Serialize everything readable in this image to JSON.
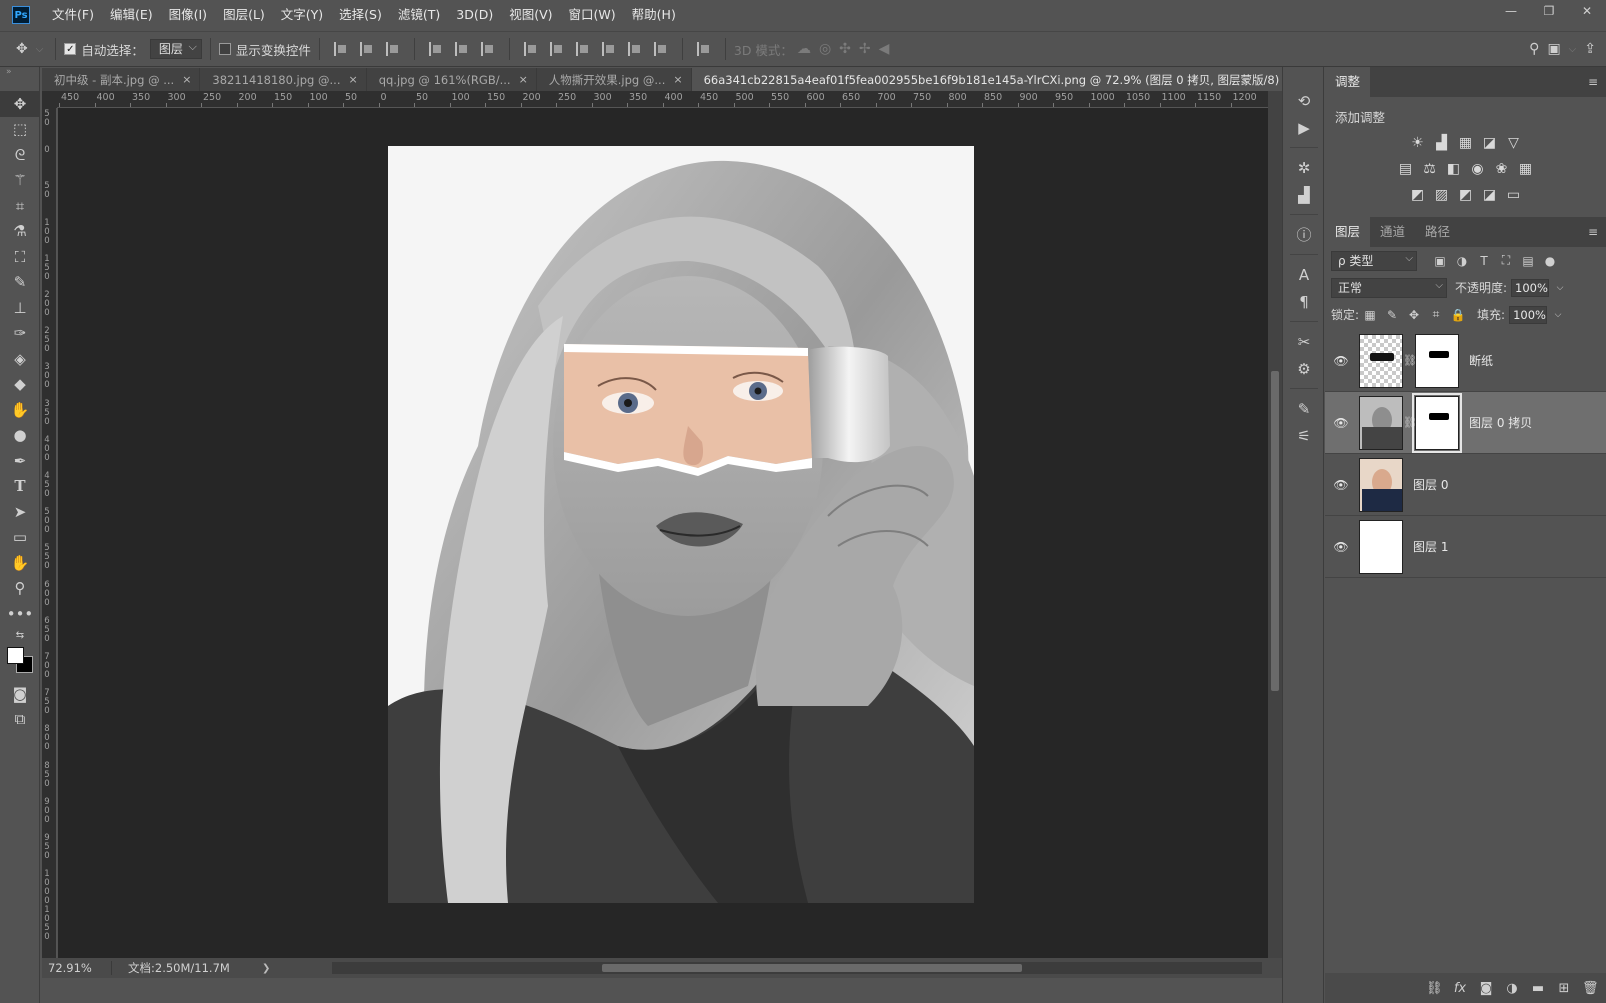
{
  "app": {
    "logo": "Ps"
  },
  "menu": [
    "文件(F)",
    "编辑(E)",
    "图像(I)",
    "图层(L)",
    "文字(Y)",
    "选择(S)",
    "滤镜(T)",
    "3D(D)",
    "视图(V)",
    "窗口(W)",
    "帮助(H)"
  ],
  "window_controls": {
    "minimize": "—",
    "restore": "❐",
    "close": "✕"
  },
  "options": {
    "auto_select_label": "自动选择：",
    "auto_select_checked": true,
    "auto_select_target": "图层",
    "show_transform_label": "显示变换控件",
    "show_transform_checked": false,
    "mode_3d_label": "3D 模式："
  },
  "tabs": [
    {
      "title": "初中级 - 副本.jpg @ ...",
      "close": "×",
      "active": false
    },
    {
      "title": "38211418180.jpg @...",
      "close": "×",
      "active": false
    },
    {
      "title": "qq.jpg @ 161%(RGB/...",
      "close": "×",
      "active": false
    },
    {
      "title": "人物撕开效果.jpg @...",
      "close": "×",
      "active": false
    },
    {
      "title": "66a341cb22815a4eaf01f5fea002955be16f9b181e145a-YlrCXi.png @ 72.9% (图层 0 拷贝, 图层蒙版/8) *",
      "close": "×",
      "active": true
    }
  ],
  "ruler": {
    "horizontal": [
      "450",
      "400",
      "350",
      "300",
      "250",
      "200",
      "150",
      "100",
      "50",
      "0",
      "50",
      "100",
      "150",
      "200",
      "250",
      "300",
      "350",
      "400",
      "450",
      "500",
      "550",
      "600",
      "650",
      "700",
      "750",
      "800",
      "850",
      "900",
      "950",
      "1000",
      "1050",
      "1100",
      "1150",
      "1200"
    ],
    "vertical": [
      "5 0",
      "0",
      "5 0",
      "1 0 0",
      "1 5 0",
      "2 0 0",
      "2 5 0",
      "3 0 0",
      "3 5 0",
      "4 0 0",
      "4 5 0",
      "5 0 0",
      "5 5 0",
      "6 0 0",
      "6 5 0",
      "7 0 0",
      "7 5 0",
      "8 0 0",
      "8 5 0",
      "9 0 0",
      "9 5 0",
      "1 0 0 0",
      "1 0 5 0"
    ]
  },
  "status": {
    "zoom": "72.91%",
    "doc_info": "文档:2.50M/11.7M",
    "arrow": "❯"
  },
  "adjustments": {
    "tab_label": "调整",
    "title": "添加调整",
    "row1": [
      "☀",
      "▟",
      "▦",
      "◪",
      "▽"
    ],
    "row2": [
      "▤",
      "⚖",
      "◧",
      "◉",
      "❀",
      "▦"
    ],
    "row3": [
      "◩",
      "▨",
      "◩",
      "◪",
      "▭"
    ]
  },
  "layers_panel": {
    "tabs": [
      "图层",
      "通道",
      "路径"
    ],
    "filter_kind": "ρ 类型",
    "blend_mode": "正常",
    "opacity_label": "不透明度:",
    "opacity_value": "100%",
    "lock_label": "锁定:",
    "fill_label": "填充:",
    "fill_value": "100%",
    "layers": [
      {
        "name": "断纸",
        "visible": true,
        "has_mask": true,
        "selected": false
      },
      {
        "name": "图层 0 拷贝",
        "visible": true,
        "has_mask": true,
        "selected": true
      },
      {
        "name": "图层 0",
        "visible": true,
        "has_mask": false,
        "selected": false
      },
      {
        "name": "图层 1",
        "visible": true,
        "has_mask": false,
        "selected": false
      }
    ],
    "footer_icons": [
      "link-icon",
      "fx-icon",
      "mask-icon",
      "adjustment-icon",
      "folder-icon",
      "new-layer-icon",
      "trash-icon"
    ]
  },
  "colors": {
    "accent": "#31a8ff",
    "panel": "#535353",
    "canvas": "#262626"
  }
}
